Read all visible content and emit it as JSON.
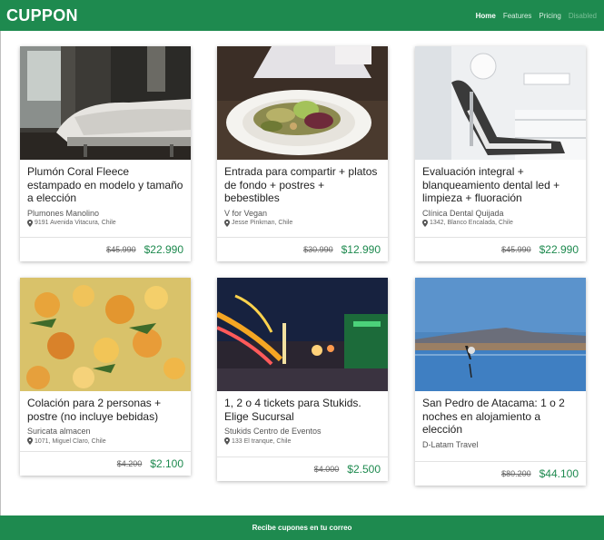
{
  "brand": {
    "name": "CUPPON"
  },
  "nav": {
    "home": "Home",
    "features": "Features",
    "pricing": "Pricing",
    "disabled": "Disabled"
  },
  "deals": [
    {
      "title": "Plumón Coral Fleece estampado en modelo y tamaño a elección",
      "merchant": "Plumones Manolino",
      "address": "9191 Avenida Vitacura, Chile",
      "price_old": "$45.990",
      "price_new": "$22.990",
      "image": "bedroom-photo"
    },
    {
      "title": "Entrada para compartir + platos de fondo + postres + bebestibles",
      "merchant": "V for Vegan",
      "address": "Jesse Pinkman, Chile",
      "price_old": "$30.990",
      "price_new": "$12.990",
      "image": "salad-plate-photo"
    },
    {
      "title": "Evaluación integral + blanqueamiento dental led + limpieza + fluoración",
      "merchant": "Clínica Dental Quijada",
      "address": "1342, Blanco Encalada, Chile",
      "price_old": "$45.990",
      "price_new": "$22.990",
      "image": "dental-chair-photo"
    },
    {
      "title": "Colación para 2 personas + postre (no incluye bebidas)",
      "merchant": "Suricata almacen",
      "address": "1071, Miguel Claro, Chile",
      "price_old": "$4.200",
      "price_new": "$2.100",
      "image": "curry-dish-photo"
    },
    {
      "title": "1, 2 o 4 tickets para Stukids. Elige Sucursal",
      "merchant": "Stukids Centro de Eventos",
      "address": "133 El tranque, Chile",
      "price_old": "$4.000",
      "price_new": "$2.500",
      "image": "amusement-park-night-photo"
    },
    {
      "title": "San Pedro de Atacama: 1 o 2 noches en alojamiento a elección",
      "merchant": "D-Latam Travel",
      "address": "",
      "price_old": "$80.200",
      "price_new": "$44.100",
      "image": "atacama-lagoon-flamingo-photo"
    }
  ],
  "footer": {
    "text": "Recibe cupones en tu correo"
  },
  "colors": {
    "brand_green": "#1e8a4f",
    "price_green": "#1e8a4f"
  },
  "icons": {
    "address": "map-pin-icon"
  }
}
